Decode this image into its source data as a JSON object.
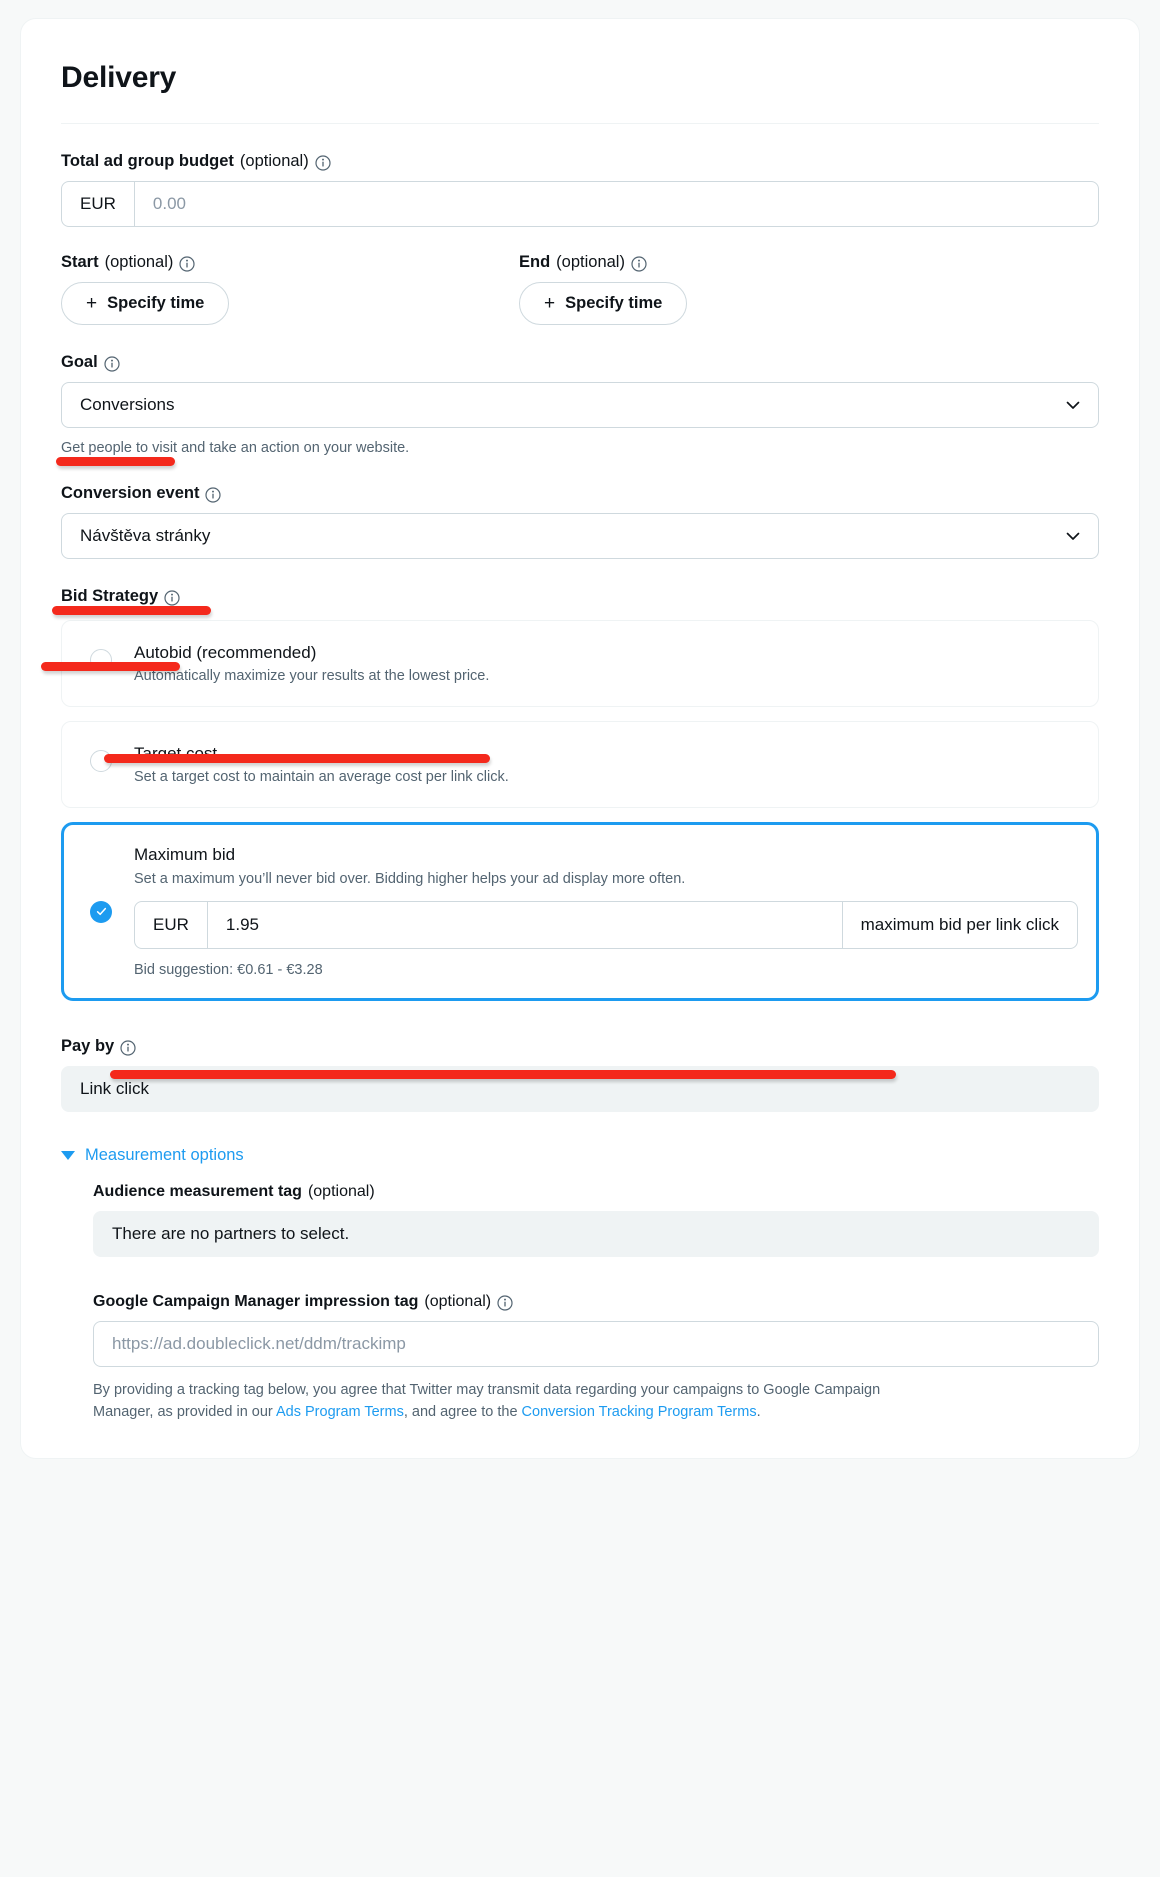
{
  "header": {
    "title": "Delivery"
  },
  "budget": {
    "label": "Total ad group budget",
    "optional": " (optional)",
    "currency": "EUR",
    "placeholder": "0.00"
  },
  "schedule": {
    "start": {
      "label": "Start",
      "optional": " (optional)",
      "button": "Specify time"
    },
    "end": {
      "label": "End",
      "optional": " (optional)",
      "button": "Specify time"
    },
    "plus": "+"
  },
  "goal": {
    "label": "Goal",
    "value": "Conversions",
    "help": "Get people to visit and take an action on your website."
  },
  "conversion_event": {
    "label": "Conversion event",
    "value": "Návštěva stránky"
  },
  "bid_strategy": {
    "label": "Bid Strategy",
    "options": [
      {
        "title": "Autobid (recommended)",
        "desc": "Automatically maximize your results at the lowest price.",
        "selected": false
      },
      {
        "title": "Target cost",
        "desc": "Set a target cost to maintain an average cost per link click.",
        "selected": false
      },
      {
        "title": "Maximum bid",
        "desc": "Set a maximum you’ll never bid over. Bidding higher helps your ad display more often.",
        "selected": true
      }
    ],
    "max_bid": {
      "currency": "EUR",
      "value": "1.95",
      "suffix": "maximum bid per link click",
      "suggestion": "Bid suggestion: €0.61 - €3.28"
    }
  },
  "pay_by": {
    "label": "Pay by",
    "value": "Link click"
  },
  "measurement": {
    "toggle_label": "Measurement options",
    "audience_tag": {
      "label": "Audience measurement tag",
      "optional": " (optional)",
      "value": "There are no partners to select."
    },
    "gcm_tag": {
      "label": "Google Campaign Manager impression tag",
      "optional": " (optional)",
      "placeholder": "https://ad.doubleclick.net/ddm/trackimp"
    },
    "legal": {
      "part1": "By providing a tracking tag below, you agree that Twitter may transmit data regarding your campaigns to Google Campaign Manager, as provided in our ",
      "link1": "Ads Program Terms",
      "part2": ", and agree to the ",
      "link2": "Conversion Tracking Program Terms",
      "part3": "."
    }
  },
  "colors": {
    "accent": "#1d9bf0",
    "annotation": "#f4291c",
    "text": "#0f1419",
    "muted": "#536471"
  }
}
